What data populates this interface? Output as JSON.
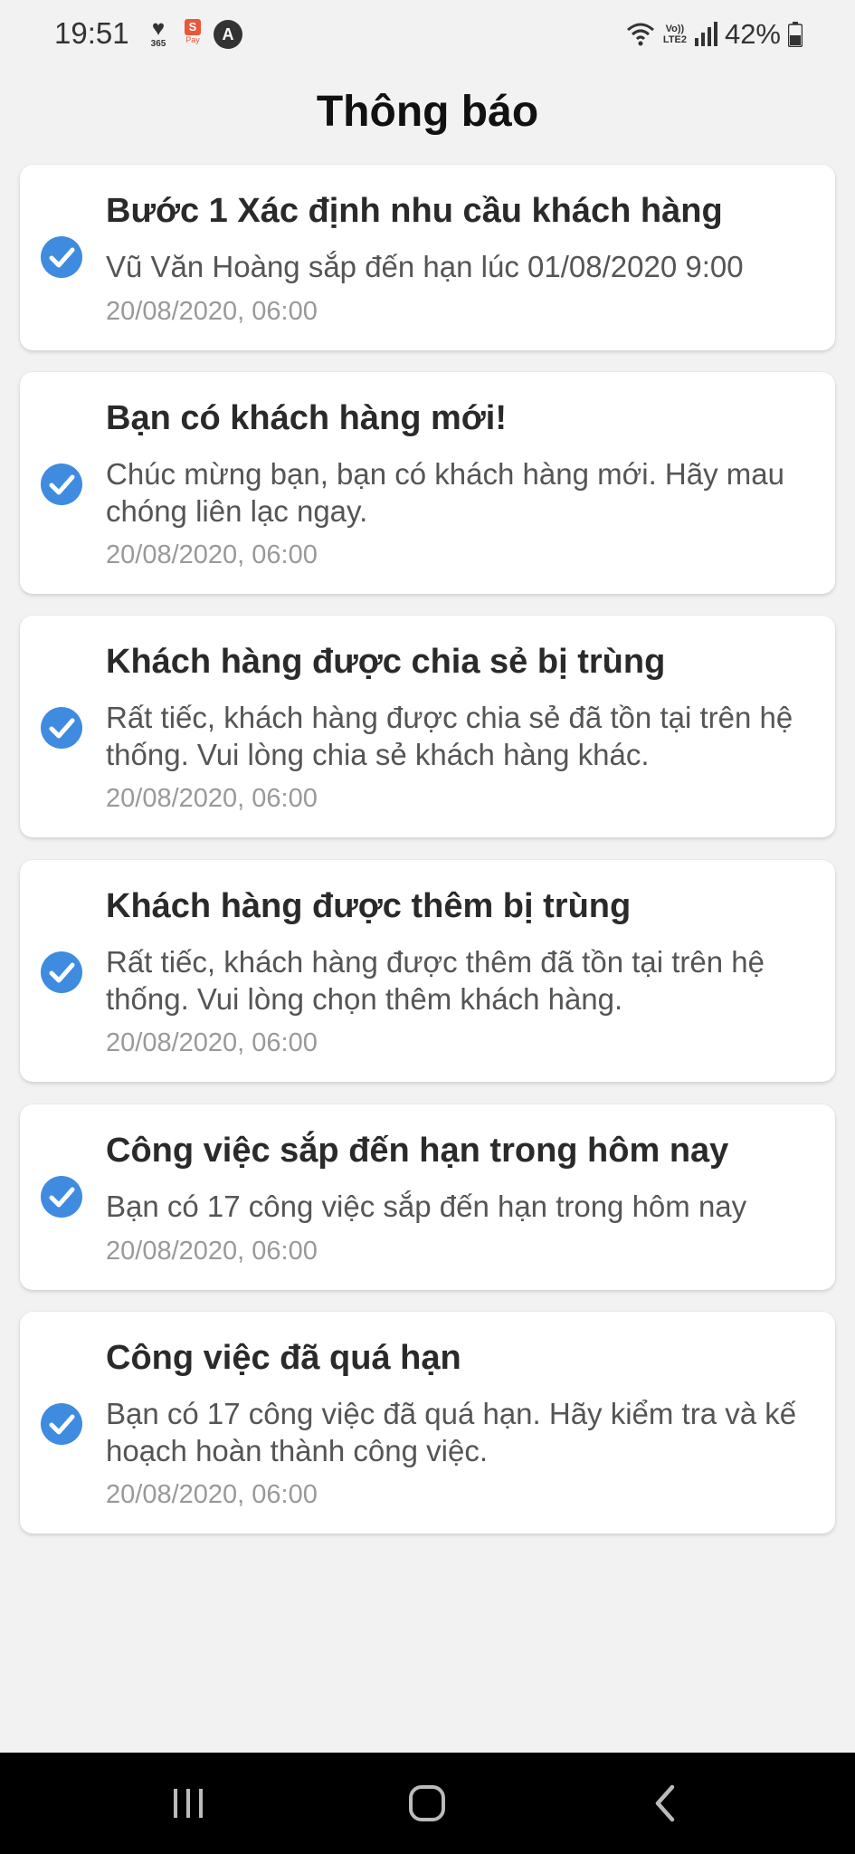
{
  "status_bar": {
    "time": "19:51",
    "heart_app_label": "365",
    "spay_letter": "S",
    "spay_label": "Pay",
    "a_app_letter": "A",
    "network_label_top": "Vo))",
    "network_label_bottom": "LTE2",
    "battery": "42%"
  },
  "header": {
    "title": "Thông báo"
  },
  "notifications": [
    {
      "title": "Bước 1 Xác định nhu cầu khách hàng",
      "body": "Vũ Văn Hoàng sắp đến hạn lúc 01/08/2020 9:00",
      "time": "20/08/2020, 06:00"
    },
    {
      "title": "Bạn có khách hàng mới!",
      "body": "Chúc mừng bạn, bạn có khách hàng mới. Hãy mau chóng liên lạc ngay.",
      "time": "20/08/2020, 06:00"
    },
    {
      "title": "Khách hàng được chia sẻ bị trùng",
      "body": "Rất tiếc, khách hàng được chia sẻ đã tồn tại trên hệ thống. Vui lòng chia sẻ khách hàng khác.",
      "time": "20/08/2020, 06:00"
    },
    {
      "title": "Khách hàng được thêm bị trùng",
      "body": "Rất tiếc, khách hàng được thêm đã tồn tại trên hệ thống. Vui lòng chọn thêm khách hàng.",
      "time": "20/08/2020, 06:00"
    },
    {
      "title": "Công việc sắp đến hạn trong hôm nay",
      "body": "Bạn có 17 công việc sắp đến hạn trong hôm nay",
      "time": "20/08/2020, 06:00"
    },
    {
      "title": "Công việc đã quá hạn",
      "body": "Bạn có 17 công việc đã quá hạn. Hãy kiểm tra và kế hoạch hoàn thành công việc.",
      "time": "20/08/2020, 06:00"
    }
  ],
  "icons": {
    "check": "check-circle-icon",
    "recents": "recent-apps-icon",
    "home": "home-icon",
    "back": "back-icon"
  },
  "colors": {
    "accent": "#3e8be0",
    "background": "#f2f2f2",
    "card": "#ffffff",
    "nav": "#000000"
  }
}
